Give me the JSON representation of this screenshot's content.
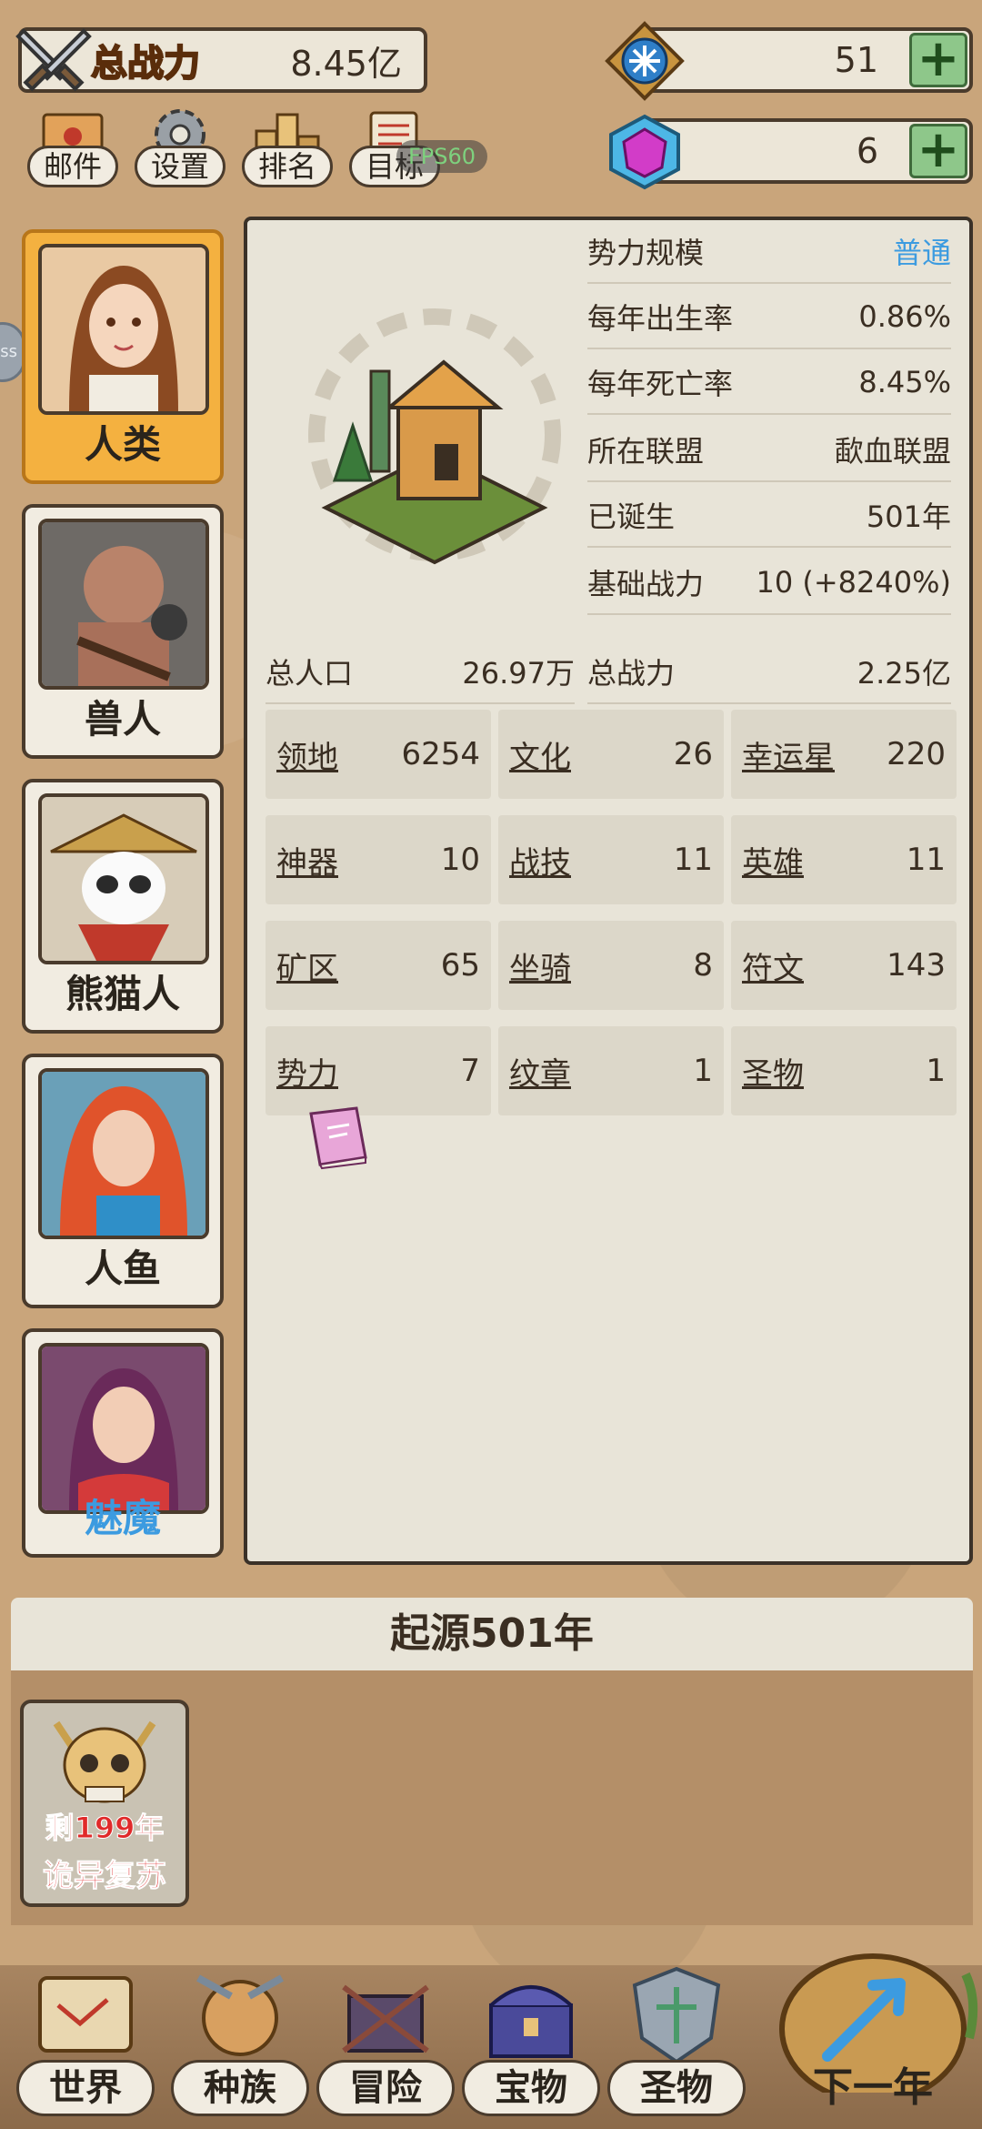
{
  "header": {
    "power_label": "总战力",
    "power_value": "8.45亿",
    "gem_blue_value": "51",
    "gem_pink_value": "6",
    "plus": "+"
  },
  "menu": {
    "mail": "邮件",
    "settings": "设置",
    "rank": "排名",
    "goal": "目标",
    "fps": "FPS60"
  },
  "side_tab": "ss",
  "races": [
    {
      "name": "人类",
      "active": true
    },
    {
      "name": "兽人",
      "active": false
    },
    {
      "name": "熊猫人",
      "active": false
    },
    {
      "name": "人鱼",
      "active": false
    },
    {
      "name": "魅魔",
      "active": false
    }
  ],
  "stats": [
    {
      "k": "势力规模",
      "v": "普通"
    },
    {
      "k": "每年出生率",
      "v": "0.86%"
    },
    {
      "k": "每年死亡率",
      "v": "8.45%"
    },
    {
      "k": "所在联盟",
      "v": "歃血联盟"
    },
    {
      "k": "已诞生",
      "v": "501年"
    },
    {
      "k": "基础战力",
      "v": "10 (+8240%)"
    },
    {
      "k": "总战力",
      "v": "2.25亿"
    }
  ],
  "population": {
    "k": "总人口",
    "v": "26.97万"
  },
  "grid": [
    {
      "k": "领地",
      "v": "6254"
    },
    {
      "k": "文化",
      "v": "26"
    },
    {
      "k": "幸运星",
      "v": "220"
    },
    {
      "k": "神器",
      "v": "10"
    },
    {
      "k": "战技",
      "v": "11"
    },
    {
      "k": "英雄",
      "v": "11"
    },
    {
      "k": "矿区",
      "v": "65"
    },
    {
      "k": "坐骑",
      "v": "8"
    },
    {
      "k": "符文",
      "v": "143"
    },
    {
      "k": "势力",
      "v": "7"
    },
    {
      "k": "纹章",
      "v": "1"
    },
    {
      "k": "圣物",
      "v": "1"
    }
  ],
  "era": {
    "title": "起源501年"
  },
  "event": {
    "line1": "剩199年",
    "line2": "诡异复苏"
  },
  "nav": {
    "world": "世界",
    "race": "种族",
    "adventure": "冒险",
    "treasure": "宝物",
    "relic": "圣物",
    "next_year": "下一年"
  },
  "colors": {
    "accent_orange": "#f4b140",
    "link_blue": "#3c9be0",
    "alert_red": "#e02a2a",
    "plus_green": "#8ec78a"
  }
}
